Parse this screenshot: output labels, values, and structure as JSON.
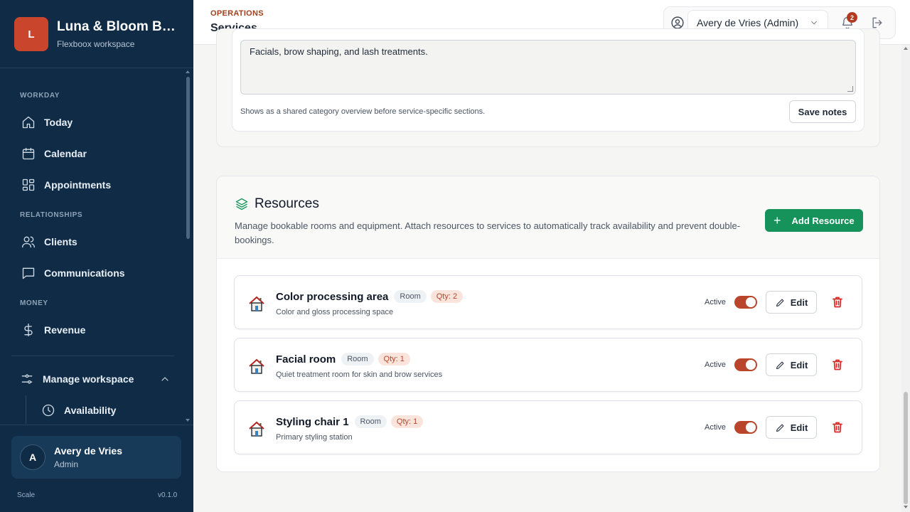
{
  "brand": {
    "initial": "L",
    "name": "Luna & Bloom Beauty",
    "workspace": "Flexboox workspace"
  },
  "nav": {
    "sections": [
      {
        "label": "WORKDAY",
        "items": [
          "Today",
          "Calendar",
          "Appointments"
        ]
      },
      {
        "label": "RELATIONSHIPS",
        "items": [
          "Clients",
          "Communications"
        ]
      },
      {
        "label": "MONEY",
        "items": [
          "Revenue"
        ]
      }
    ],
    "manage_label": "Manage workspace",
    "sub_items": [
      "Availability"
    ]
  },
  "user": {
    "initial": "A",
    "name": "Avery de Vries",
    "role": "Admin"
  },
  "footer": {
    "left": "Scale",
    "version": "v0.1.0"
  },
  "header": {
    "breadcrumb": "OPERATIONS",
    "title": "Services",
    "user_select": "Avery de Vries (Admin)",
    "notification_count": "2"
  },
  "notes": {
    "text": "Facials, brow shaping, and lash treatments.",
    "help": "Shows as a shared category overview before service-specific sections.",
    "save_label": "Save notes"
  },
  "resources": {
    "title": "Resources",
    "description": "Manage bookable rooms and equipment. Attach resources to services to automatically track availability and prevent double-bookings.",
    "add_label": "Add Resource",
    "items": [
      {
        "name": "Color processing area",
        "type": "Room",
        "qty": "Qty: 2",
        "desc": "Color and gloss processing space",
        "status": "Active",
        "edit": "Edit",
        "active": true
      },
      {
        "name": "Facial room",
        "type": "Room",
        "qty": "Qty: 1",
        "desc": "Quiet treatment room for skin and brow services",
        "status": "Active",
        "edit": "Edit",
        "active": true
      },
      {
        "name": "Styling chair 1",
        "type": "Room",
        "qty": "Qty: 1",
        "desc": "Primary styling station",
        "status": "Active",
        "edit": "Edit",
        "active": true
      }
    ]
  },
  "colors": {
    "sidebar": "#0f2b45",
    "accent": "#c9462c",
    "primary": "#15935a",
    "danger": "#dc2626"
  },
  "icons": [
    "home-icon",
    "calendar-icon",
    "grid-icon",
    "users-icon",
    "message-icon",
    "dollar-icon",
    "sliders-icon",
    "chevron-up-icon",
    "clock-icon",
    "user-circle-icon",
    "chevron-down-icon",
    "bell-icon",
    "logout-icon",
    "layers-icon",
    "house-icon",
    "pencil-icon",
    "trash-icon"
  ]
}
